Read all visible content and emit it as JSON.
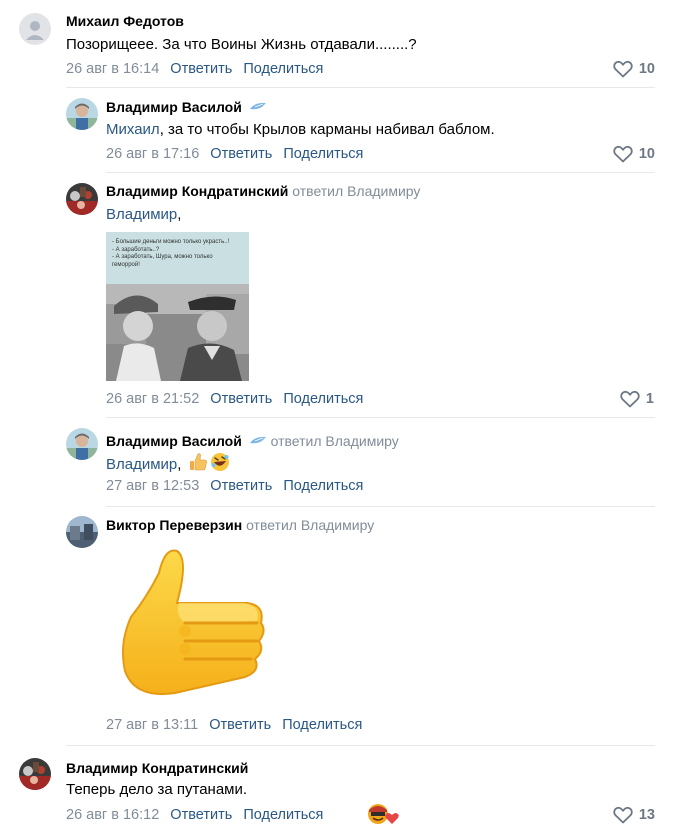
{
  "comments": [
    {
      "author": "Михаил Федотов",
      "text": "Позорищеее. За что Воины Жизнь отдавали........?",
      "time": "26 авг в 16:14",
      "reply_label": "Ответить",
      "share_label": "Поделиться",
      "likes": "10"
    },
    {
      "author": "Владимир Василой",
      "mention": "Михаил",
      "text": ", за то чтобы Крылов карманы набивал баблом.",
      "time": "26 авг в 17:16",
      "reply_label": "Ответить",
      "share_label": "Поделиться",
      "likes": "10"
    },
    {
      "author": "Владимир Кондратинский",
      "reply_to": "ответил Владимиру",
      "mention": "Владимир",
      "text": ",",
      "attachment_caption": "- Большие деньги можно только украсть..!\n- А заработать..?\n- А заработать, Шура, можно только геморрой!",
      "time": "26 авг в 21:52",
      "reply_label": "Ответить",
      "share_label": "Поделиться",
      "likes": "1"
    },
    {
      "author": "Владимир Василой",
      "reply_to": "ответил Владимиру",
      "mention": "Владимир",
      "text": ",",
      "time": "27 авг в 12:53",
      "reply_label": "Ответить",
      "share_label": "Поделиться"
    },
    {
      "author": "Виктор Переверзин",
      "reply_to": "ответил Владимиру",
      "sticker": "thumbs-up",
      "time": "27 авг в 13:11",
      "reply_label": "Ответить",
      "share_label": "Поделиться"
    },
    {
      "author": "Владимир Кондратинский",
      "text": "Теперь дело за путанами.",
      "time": "26 авг в 16:12",
      "reply_label": "Ответить",
      "share_label": "Поделиться",
      "likes": "13"
    }
  ],
  "colors": {
    "link": "#2a5885",
    "secondary": "#818c99",
    "divider": "#e7e8ec"
  },
  "icons": [
    "heart-icon",
    "thumbs-up-emoji",
    "rofl-emoji",
    "thumbs-up-sticker",
    "reaction-emoji",
    "edit-icon"
  ]
}
